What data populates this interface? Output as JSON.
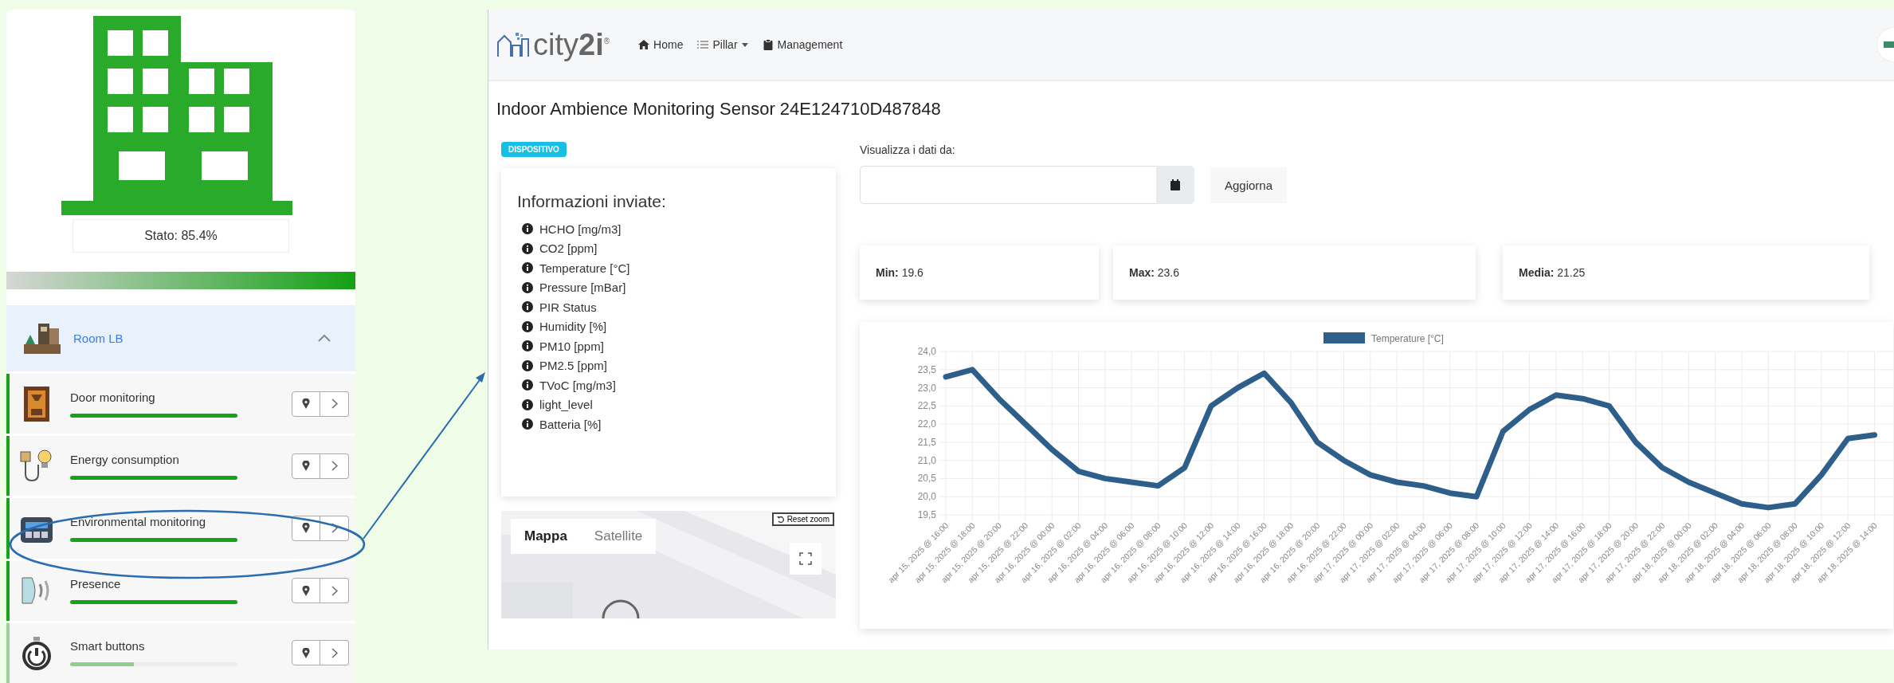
{
  "sidebar": {
    "status": "Stato: 85.4%",
    "room": {
      "name": "Room LB",
      "expanded": true,
      "items": [
        {
          "name": "Door monitoring",
          "kind": "door",
          "level": 1
        },
        {
          "name": "Energy consumption",
          "kind": "energy",
          "level": 1
        },
        {
          "name": "Environmental monitoring",
          "kind": "environment",
          "level": 1
        },
        {
          "name": "Presence",
          "kind": "presence",
          "level": 1
        },
        {
          "name": "Smart buttons",
          "kind": "button",
          "level": 0.38
        }
      ]
    }
  },
  "app": {
    "logo": "city**2i**$^{®}$",
    "nav": [
      {
        "label": "Home",
        "dropdown": false
      },
      {
        "label": "Pillar",
        "dropdown": true
      },
      {
        "label": "Management",
        "dropdown": false
      }
    ],
    "title": "Indoor Ambience Monitoring Sensor 24E124710D487848",
    "badge": "DISPOSITIVO",
    "info": {
      "heading": "Informazioni inviate:",
      "items": [
        "HCHO [mg/m3]",
        "CO2 [ppm]",
        "Temperature [°C]",
        "Pressure [mBar]",
        "PIR Status",
        "Humidity [%]",
        "PM10 [ppm]",
        "PM2.5 [ppm]",
        "TVoC [mg/m3]",
        "light_level",
        "Batteria [%]"
      ]
    },
    "map": {
      "tabs": [
        {
          "label": "Mappa",
          "selected": true
        },
        {
          "label": "Satellite",
          "selected": false
        }
      ],
      "reset_zoom": "Reset zoom"
    },
    "filter": {
      "label": "Visualizza i dati da:",
      "button": "Aggiorna"
    },
    "stats": [
      {
        "label": "Min:",
        "value": "19.6"
      },
      {
        "label": "Max:",
        "value": "23.6"
      },
      {
        "label": "Media:",
        "value": "21.25"
      }
    ],
    "chart": {
      "chart_data": {
        "type": "line",
        "grid": true,
        "categories": [
          "apr 15, 2025 @ 16:00",
          "apr 15, 2025 @ 18:00",
          "apr 15, 2025 @ 20:00",
          "apr 15, 2025 @ 22:00",
          "apr 16, 2025 @ 00:00",
          "apr 16, 2025 @ 02:00",
          "apr 16, 2025 @ 04:00",
          "apr 16, 2025 @ 06:00",
          "apr 16, 2025 @ 08:00",
          "apr 16, 2025 @ 10:00",
          "apr 16, 2025 @ 12:00",
          "apr 16, 2025 @ 14:00",
          "apr 16, 2025 @ 16:00",
          "apr 16, 2025 @ 18:00",
          "apr 16, 2025 @ 20:00",
          "apr 16, 2025 @ 22:00",
          "apr 17, 2025 @ 00:00",
          "apr 17, 2025 @ 02:00",
          "apr 17, 2025 @ 04:00",
          "apr 17, 2025 @ 06:00",
          "apr 17, 2025 @ 08:00",
          "apr 17, 2025 @ 10:00",
          "apr 17, 2025 @ 12:00",
          "apr 17, 2025 @ 14:00",
          "apr 17, 2025 @ 16:00",
          "apr 17, 2025 @ 18:00",
          "apr 17, 2025 @ 20:00",
          "apr 17, 2025 @ 22:00",
          "apr 18, 2025 @ 00:00",
          "apr 18, 2025 @ 02:00",
          "apr 18, 2025 @ 04:00",
          "apr 18, 2025 @ 06:00",
          "apr 18, 2025 @ 08:00",
          "apr 18, 2025 @ 10:00",
          "apr 18, 2025 @ 12:00",
          "apr 18, 2025 @ 14:00"
        ],
        "series": [
          {
            "name": "Temperature [°C]",
            "color": "#2e5f8a",
            "values": [
              23.3,
              23.5,
              22.7,
              22.0,
              21.3,
              20.7,
              20.5,
              20.4,
              20.3,
              20.8,
              22.5,
              23.0,
              23.4,
              22.6,
              21.5,
              21.0,
              20.6,
              20.4,
              20.3,
              20.1,
              20.0,
              21.8,
              22.4,
              22.8,
              22.7,
              22.5,
              21.5,
              20.8,
              20.4,
              20.1,
              19.8,
              19.7,
              19.8,
              20.6,
              21.6,
              21.7
            ]
          }
        ],
        "ylim": [
          19.5,
          24.0
        ],
        "yticks": [
          {
            "value": 19.5,
            "label": "19,5"
          },
          {
            "value": 20.0,
            "label": "20,0"
          },
          {
            "value": 20.5,
            "label": "20,5"
          },
          {
            "value": 21.0,
            "label": "21,0"
          },
          {
            "value": 21.5,
            "label": "21,5"
          },
          {
            "value": 22.0,
            "label": "22,0"
          },
          {
            "value": 22.5,
            "label": "22,5"
          },
          {
            "value": 23.0,
            "label": "23,0"
          },
          {
            "value": 23.5,
            "label": "23,5"
          },
          {
            "value": 24.0,
            "label": "24,0"
          }
        ]
      }
    }
  }
}
